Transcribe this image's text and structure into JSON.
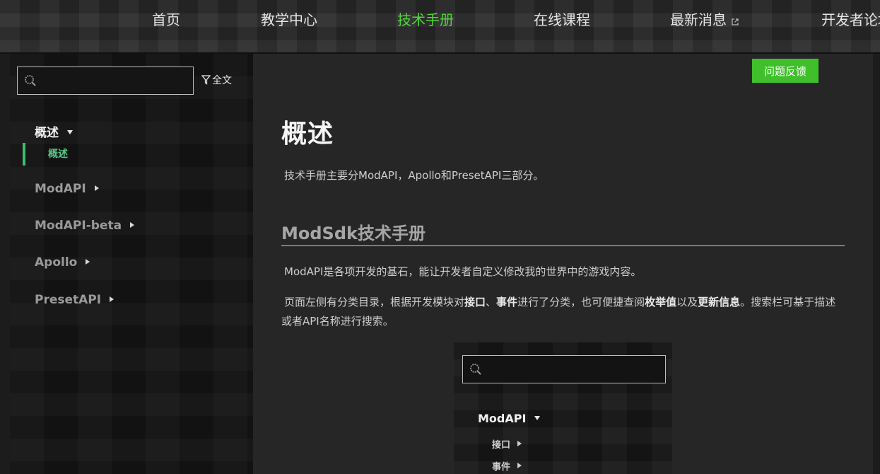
{
  "nav": {
    "items": [
      {
        "label": "首页",
        "active": false
      },
      {
        "label": "教学中心",
        "active": false
      },
      {
        "label": "技术手册",
        "active": true
      },
      {
        "label": "在线课程",
        "active": false
      },
      {
        "label": "最新消息",
        "active": false,
        "external": true
      },
      {
        "label": "开发者论坛",
        "active": false
      }
    ],
    "active_color": "#52d53c"
  },
  "sidebar": {
    "search": {
      "value": "",
      "placeholder": ""
    },
    "fulltext_label": "全文",
    "groups": [
      {
        "label": "概述",
        "open": true,
        "children": [
          {
            "label": "概述",
            "active": true
          }
        ]
      },
      {
        "label": "ModAPI",
        "open": false
      },
      {
        "label": "ModAPI-beta",
        "open": false
      },
      {
        "label": "Apollo",
        "open": false
      },
      {
        "label": "PresetAPI",
        "open": false
      }
    ],
    "active_color": "#3bbf6a"
  },
  "main": {
    "feedback_label": "问题反馈",
    "title": "概述",
    "intro": "技术手册主要分ModAPI，Apollo和PresetAPI三部分。",
    "section_title": "ModSdk技术手册",
    "para1": "ModAPI是各项开发的基石，能让开发者自定义修改我的世界中的游戏内容。",
    "para2": {
      "t1": "页面左侧有分类目录，根据开发模块对",
      "b1": "接口",
      "t2": "、",
      "b2": "事件",
      "t3": "进行了分类，也可便捷查阅",
      "b3": "枚举值",
      "t4": "以及",
      "b4": "更新信息",
      "t5": "。搜索栏可基于描述或者API名称进行搜索。"
    },
    "preview": {
      "group": "ModAPI",
      "items": [
        "接口",
        "事件"
      ]
    },
    "accent": "#3fc02b"
  }
}
